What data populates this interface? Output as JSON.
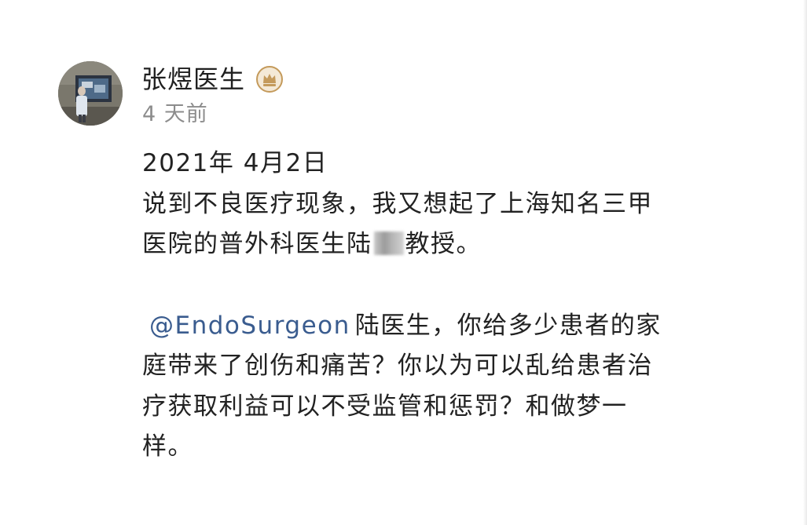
{
  "post": {
    "author": {
      "name": "张煜医生",
      "badge_icon": "crown-badge-icon",
      "badge_color": "#c49a5b"
    },
    "timestamp": "4 天前",
    "date_line": "2021年 4月2日",
    "paragraph1_a": "说到不良医疗现象，我又想起了上海知名三甲",
    "paragraph1_b_before": "医院的普外科医生陆",
    "paragraph1_b_after": "教授。",
    "mention": "@EndoSurgeon",
    "paragraph2_a": "陆医生，你给多少患者的家",
    "paragraph2_b": "庭带来了创伤和痛苦？你以为可以乱给患者治",
    "paragraph2_c": "疗获取利益可以不受监管和惩罚？和做梦一",
    "paragraph2_d": "样。",
    "mention_color": "#3a5c8f"
  }
}
